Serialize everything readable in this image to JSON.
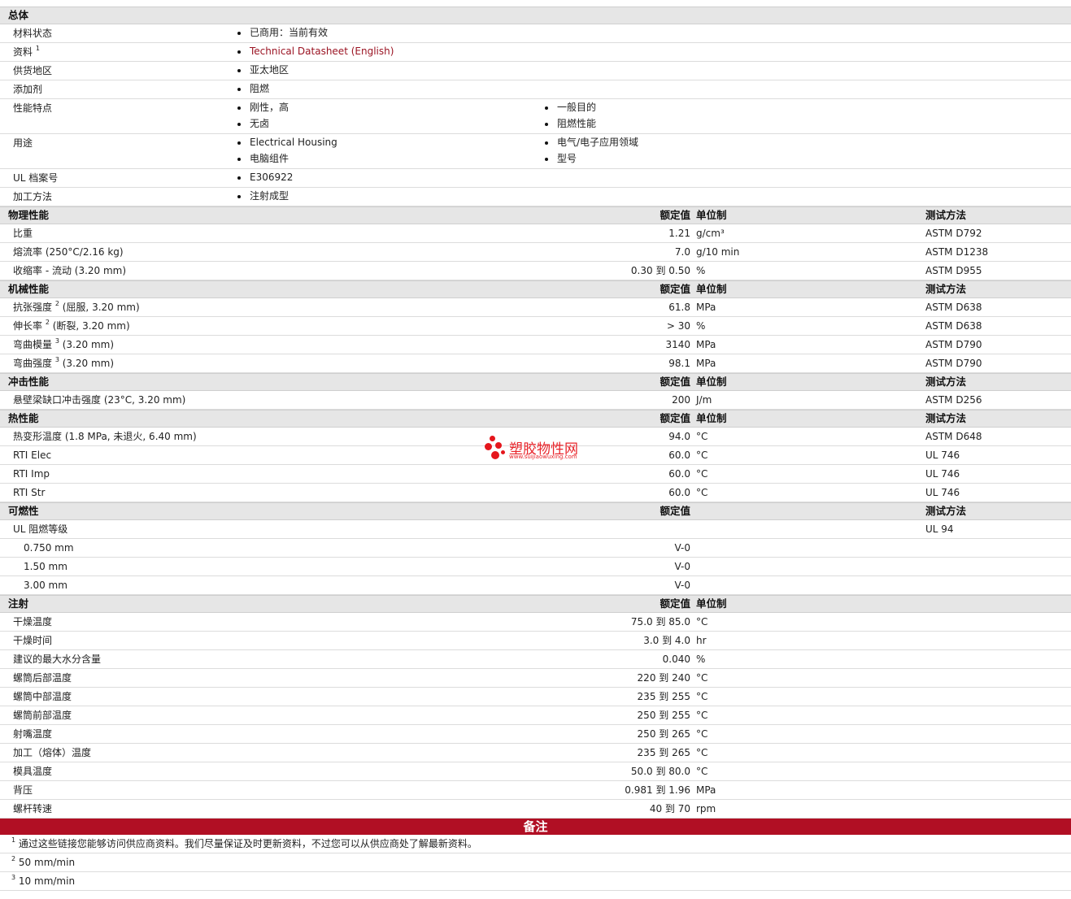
{
  "general": {
    "title": "总体",
    "status_label": "材料状态",
    "status": "已商用：当前有效",
    "docs_label": "资料",
    "docs_sup": "1",
    "docs_link": "Technical Datasheet (English)",
    "region_label": "供货地区",
    "region": "亚太地区",
    "additive_label": "添加剂",
    "additive": "阻燃",
    "features_label": "性能特点",
    "features_col1": [
      "刚性，高",
      "无卤"
    ],
    "features_col2": [
      "一般目的",
      "阻燃性能"
    ],
    "uses_label": "用途",
    "uses_col1": [
      "Electrical Housing",
      "电脑组件"
    ],
    "uses_col2": [
      "电气/电子应用领域",
      "型号"
    ],
    "ul_label": "UL 档案号",
    "ul": "E306922",
    "process_label": "加工方法",
    "process": "注射成型"
  },
  "headers": {
    "nominal": "额定值",
    "unit": "单位制",
    "method": "测试方法"
  },
  "physical": {
    "title": "物理性能",
    "rows": [
      {
        "label": "比重",
        "value": "1.21",
        "unit": "g/cm³",
        "method": "ASTM D792"
      },
      {
        "label": "熔流率  (250°C/2.16 kg)",
        "value": "7.0",
        "unit": "g/10 min",
        "method": "ASTM D1238"
      },
      {
        "label": "收缩率  - 流动  (3.20 mm)",
        "value": "0.30 到  0.50",
        "unit": "%",
        "method": "ASTM D955"
      }
    ]
  },
  "mechanical": {
    "title": "机械性能",
    "rows": [
      {
        "label": "抗张强度",
        "sup": "2",
        "suffix": " (屈服, 3.20 mm)",
        "value": "61.8",
        "unit": "MPa",
        "method": "ASTM D638"
      },
      {
        "label": "伸长率",
        "sup": "2",
        "suffix": " (断裂, 3.20 mm)",
        "value": "> 30",
        "unit": "%",
        "method": "ASTM D638"
      },
      {
        "label": "弯曲模量",
        "sup": "3",
        "suffix": " (3.20 mm)",
        "value": "3140",
        "unit": "MPa",
        "method": "ASTM D790"
      },
      {
        "label": "弯曲强度",
        "sup": "3",
        "suffix": " (3.20 mm)",
        "value": "98.1",
        "unit": "MPa",
        "method": "ASTM D790"
      }
    ]
  },
  "impact": {
    "title": "冲击性能",
    "rows": [
      {
        "label": "悬壁梁缺口冲击强度  (23°C, 3.20 mm)",
        "value": "200",
        "unit": "J/m",
        "method": "ASTM D256"
      }
    ]
  },
  "thermal": {
    "title": "热性能",
    "rows": [
      {
        "label": "热变形温度  (1.8 MPa, 未退火, 6.40 mm)",
        "value": "94.0",
        "unit": "°C",
        "method": "ASTM D648"
      },
      {
        "label": "RTI Elec",
        "value": "60.0",
        "unit": "°C",
        "method": "UL 746"
      },
      {
        "label": "RTI Imp",
        "value": "60.0",
        "unit": "°C",
        "method": "UL 746"
      },
      {
        "label": "RTI Str",
        "value": "60.0",
        "unit": "°C",
        "method": "UL 746"
      }
    ]
  },
  "flammability": {
    "title": "可燃性",
    "ul_label": "UL 阻燃等级",
    "ul_method": "UL 94",
    "rows": [
      {
        "label": "0.750 mm",
        "value": "V-0"
      },
      {
        "label": "1.50 mm",
        "value": "V-0"
      },
      {
        "label": "3.00 mm",
        "value": "V-0"
      }
    ]
  },
  "injection": {
    "title": "注射",
    "rows": [
      {
        "label": "干燥温度",
        "value": "75.0 到  85.0",
        "unit": "°C"
      },
      {
        "label": "干燥时间",
        "value": "3.0 到  4.0",
        "unit": "hr"
      },
      {
        "label": "建议的最大水分含量",
        "value": "0.040",
        "unit": "%"
      },
      {
        "label": "螺筒后部温度",
        "value": "220 到  240",
        "unit": "°C"
      },
      {
        "label": "螺筒中部温度",
        "value": "235 到  255",
        "unit": "°C"
      },
      {
        "label": "螺筒前部温度",
        "value": "250 到  255",
        "unit": "°C"
      },
      {
        "label": "射嘴温度",
        "value": "250 到  265",
        "unit": "°C"
      },
      {
        "label": "加工（熔体）温度",
        "value": "235 到  265",
        "unit": "°C"
      },
      {
        "label": "模具温度",
        "value": "50.0 到  80.0",
        "unit": "°C"
      },
      {
        "label": "背压",
        "value": "0.981 到  1.96",
        "unit": "MPa"
      },
      {
        "label": "螺杆转速",
        "value": "40 到  70",
        "unit": "rpm"
      }
    ]
  },
  "notes": {
    "title": "备注",
    "items": [
      {
        "sup": "1",
        "text": "通过这些链接您能够访问供应商资料。我们尽量保证及时更新资料，不过您可以从供应商处了解最新资料。"
      },
      {
        "sup": "2",
        "text": "50 mm/min"
      },
      {
        "sup": "3",
        "text": "10 mm/min"
      }
    ]
  },
  "watermark": {
    "name": "塑胶物性网",
    "url": "www.suijiaowuxing.com",
    "color": "#e5161c"
  },
  "colors": {
    "header_bg": "#e6e6e6",
    "notes_bar": "#b10f24",
    "link": "#9b1423"
  }
}
